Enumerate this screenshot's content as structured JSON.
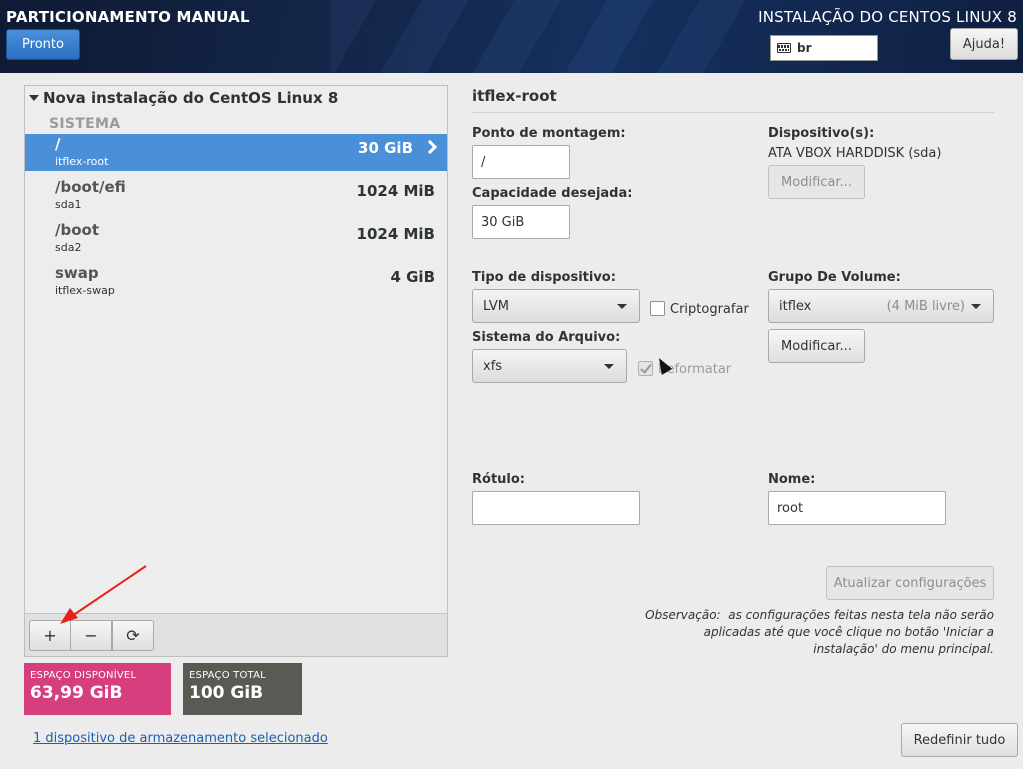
{
  "header": {
    "title": "PARTICIONAMENTO MANUAL",
    "install_title": "INSTALAÇÃO DO CENTOS LINUX 8",
    "done_button": "Pronto",
    "keyboard_layout": "br",
    "help_button": "Ajuda!"
  },
  "left": {
    "tree_title": "Nova instalação do CentOS Linux 8",
    "section": "SISTEMA",
    "mounts": [
      {
        "mount": "/",
        "device": "itflex-root",
        "size": "30 GiB",
        "selected": true
      },
      {
        "mount": "/boot/efi",
        "device": "sda1",
        "size": "1024 MiB",
        "selected": false
      },
      {
        "mount": "/boot",
        "device": "sda2",
        "size": "1024 MiB",
        "selected": false
      },
      {
        "mount": "swap",
        "device": "itflex-swap",
        "size": "4 GiB",
        "selected": false
      }
    ],
    "toolbar": {
      "add": "+",
      "remove": "−",
      "refresh": "⟳"
    }
  },
  "space": {
    "available_label": "ESPAÇO DISPONÍVEL",
    "available_value": "63,99 GiB",
    "total_label": "ESPAÇO TOTAL",
    "total_value": "100 GiB"
  },
  "storage_link": "1 dispositivo de armazenamento selecionado",
  "detail": {
    "title": "itflex-root",
    "mount_point_label": "Ponto de montagem:",
    "mount_point_value": "/",
    "capacity_label": "Capacidade desejada:",
    "capacity_value": "30 GiB",
    "devices_label": "Dispositivo(s):",
    "devices_value": "ATA VBOX HARDDISK (sda)",
    "modify_devices_button": "Modificar...",
    "device_type_label": "Tipo de dispositivo:",
    "device_type_value": "LVM",
    "encrypt_label": "Criptografar",
    "encrypt_checked": false,
    "filesystem_label": "Sistema do Arquivo:",
    "filesystem_value": "xfs",
    "reformat_label": "Reformatar",
    "reformat_checked": true,
    "volume_group_label": "Grupo De Volume:",
    "volume_group_value": "itflex",
    "volume_group_free": "(4 MiB livre)",
    "modify_vg_button": "Modificar...",
    "label_label": "Rótulo:",
    "label_value": "",
    "name_label": "Nome:",
    "name_value": "root",
    "update_button": "Atualizar configurações",
    "note_prefix": "Observação:",
    "note_body": "as configurações feitas nesta tela não serão aplicadas até que você clique no botão 'Iniciar a instalação' do menu principal.",
    "reset_button": "Redefinir tudo"
  },
  "colors": {
    "selected_row": "#4a90d9",
    "available_box": "#d63f7d",
    "total_box": "#5a5a55",
    "annotation_arrow": "#e8201a"
  }
}
